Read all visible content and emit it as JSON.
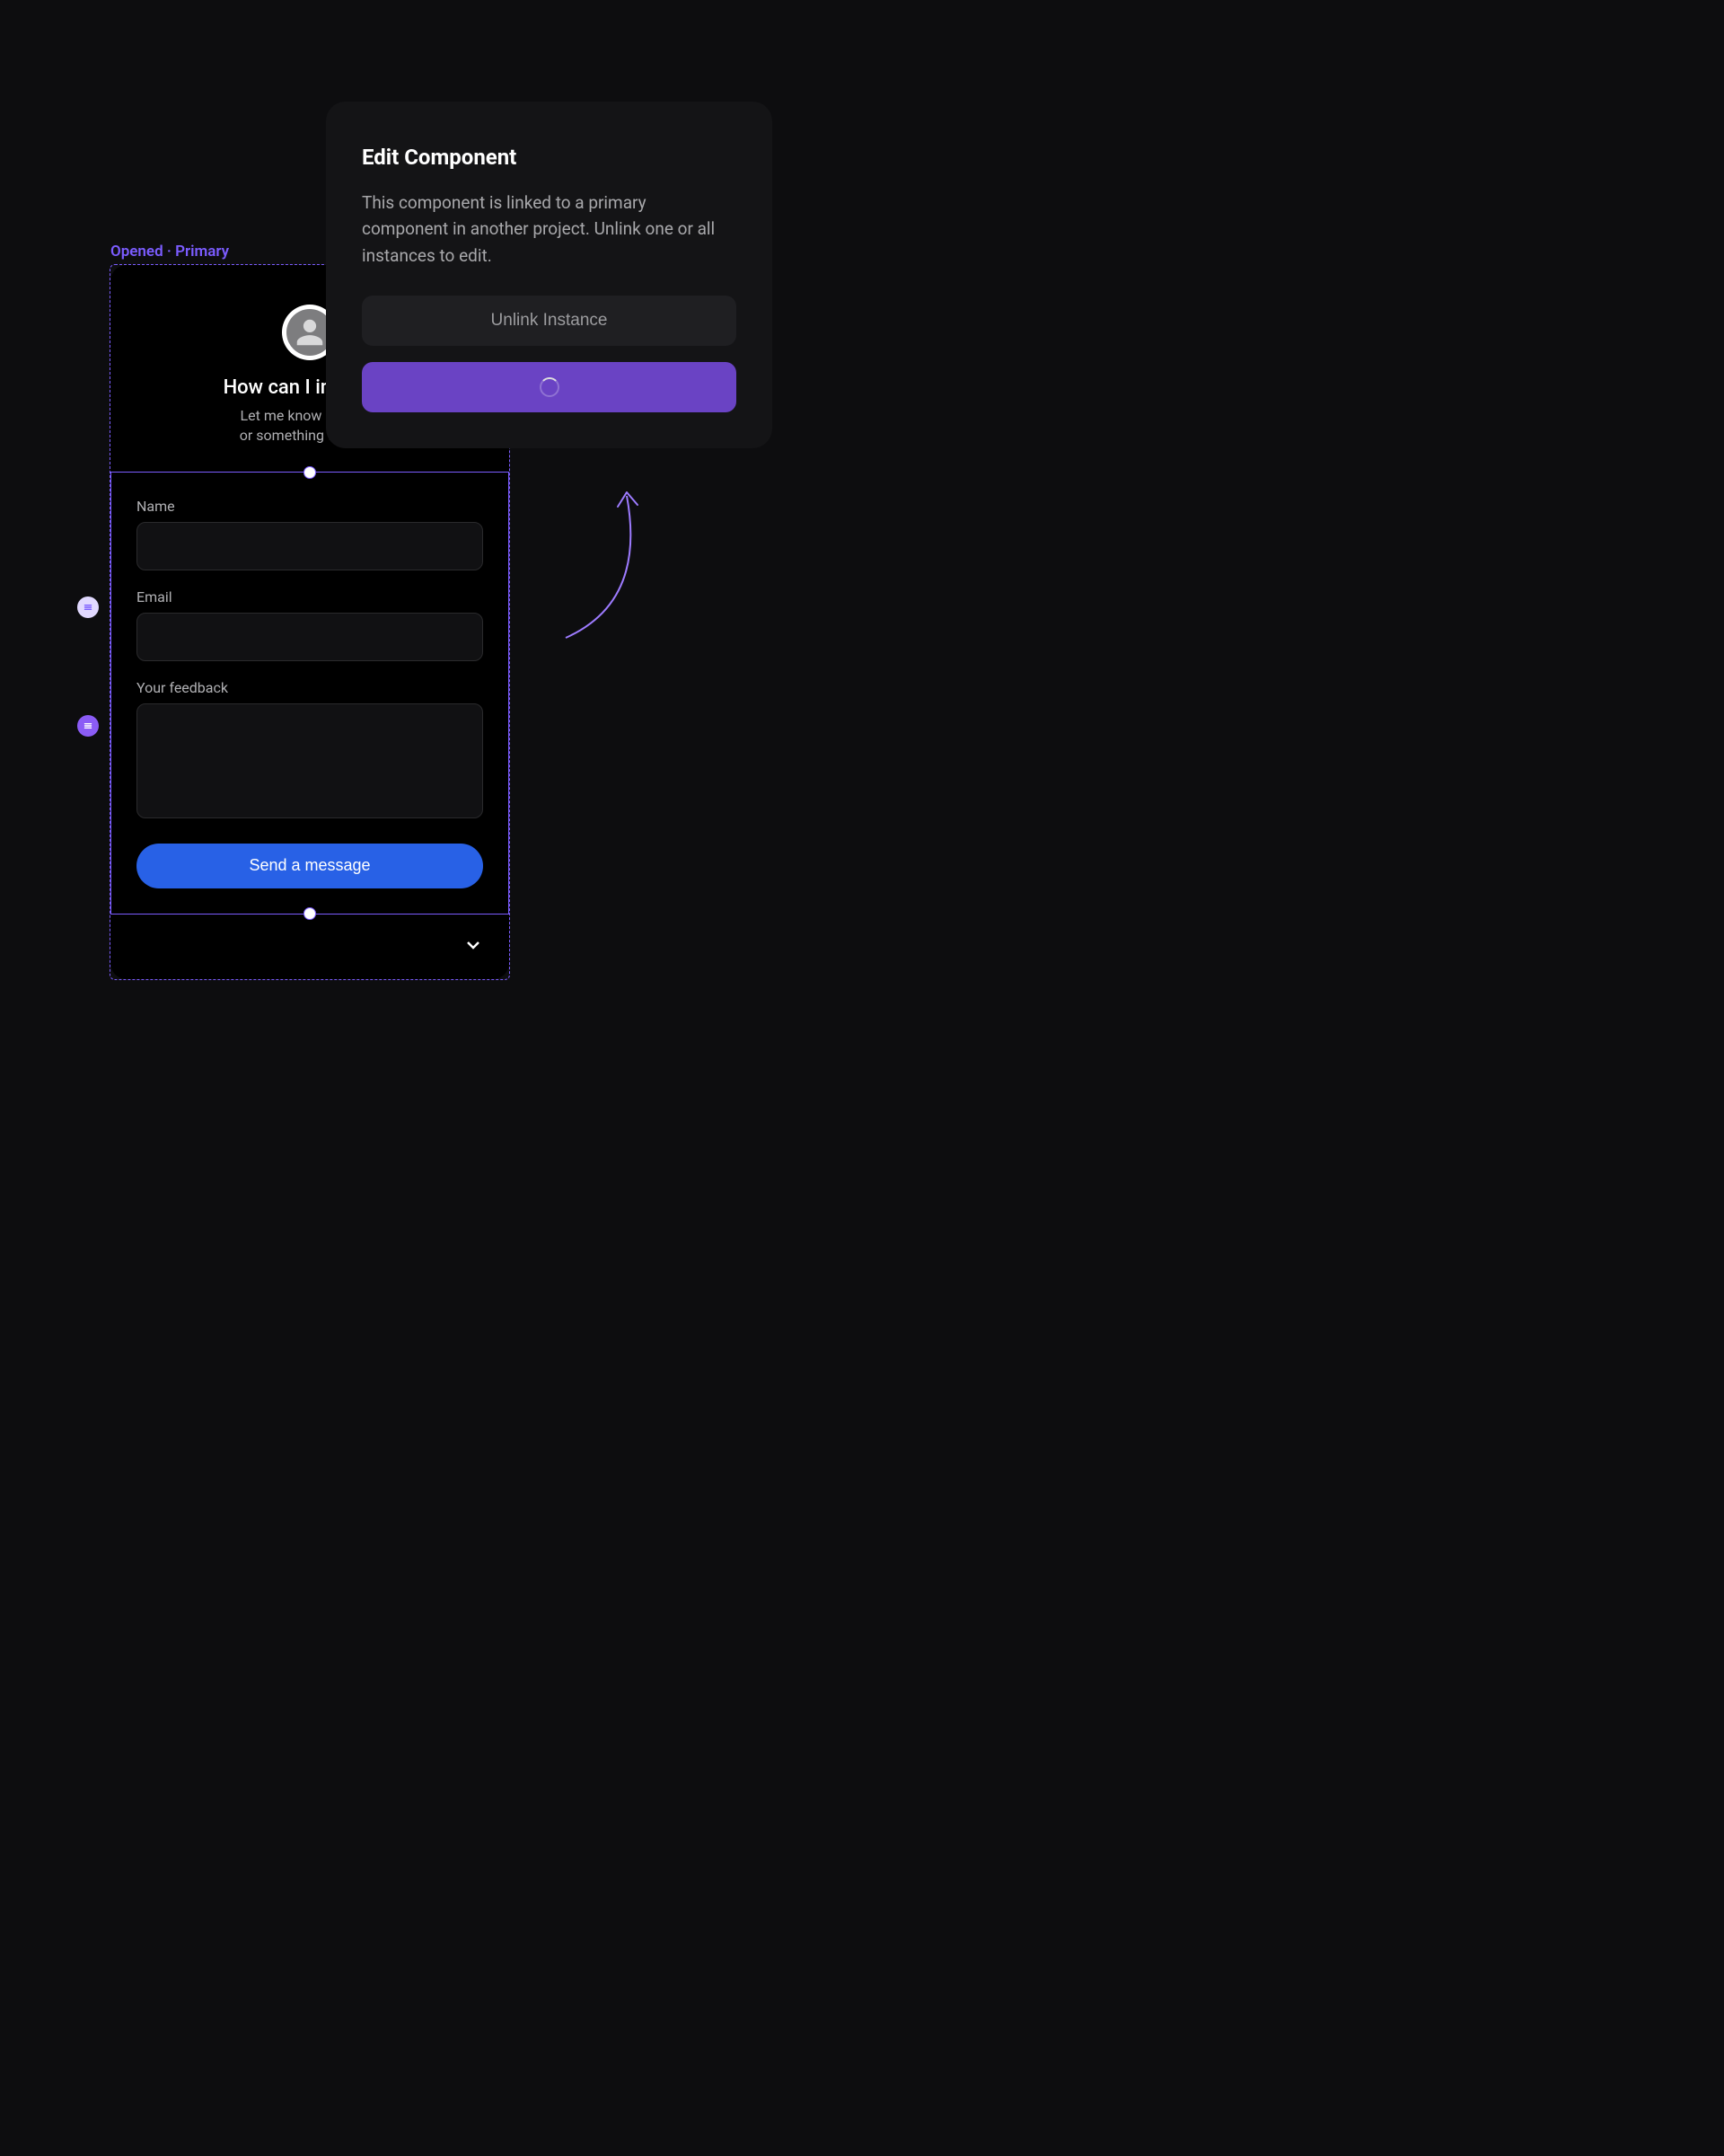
{
  "frame": {
    "label": "Opened · Primary"
  },
  "card": {
    "title": "How can I improve?",
    "subtitle_line1": "Let me know if there's",
    "subtitle_line2": "or something that cou"
  },
  "form": {
    "name_label": "Name",
    "email_label": "Email",
    "feedback_label": "Your feedback",
    "send_label": "Send a message"
  },
  "modal": {
    "title": "Edit Component",
    "description": "This component is linked to a primary component in another project. Unlink one or all instances to edit.",
    "unlink_label": "Unlink Instance"
  },
  "icons": {
    "avatar": "silhouette-icon",
    "chevron": "chevron-down-icon",
    "gutter": "list-icon",
    "spinner": "loading-spinner-icon"
  },
  "colors": {
    "accent_purple": "#7b5cff",
    "button_blue": "#2861e6",
    "modal_primary": "#6a43c4"
  }
}
